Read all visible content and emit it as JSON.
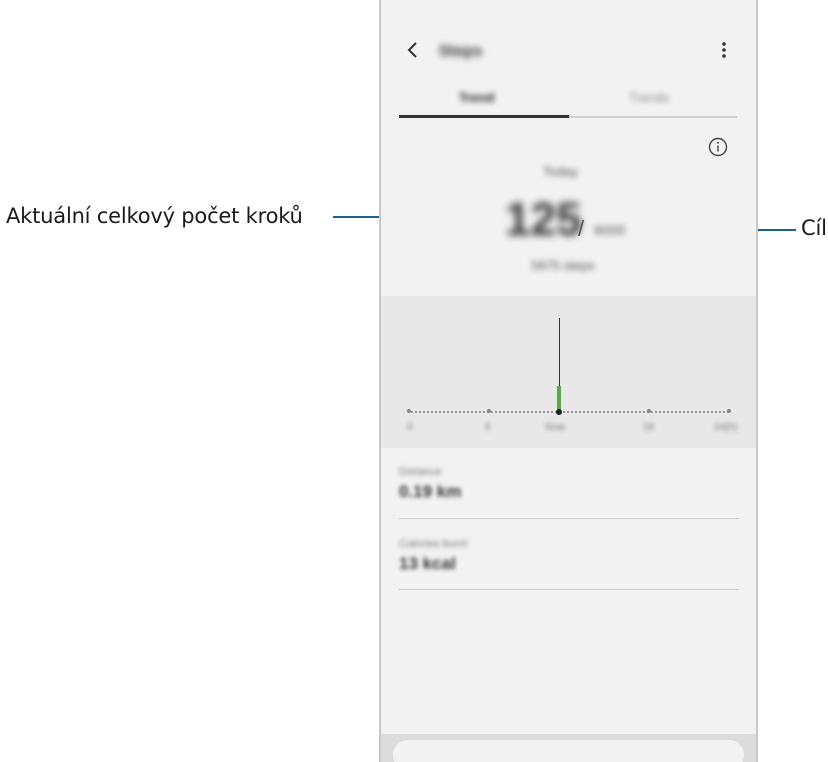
{
  "callouts": {
    "left": "Aktuální celkový počet kroků",
    "right": "Cíl"
  },
  "colors": {
    "leader": "#1f5f8b",
    "progress": "#5aa64a"
  },
  "app": {
    "title": "Steps",
    "back_icon": "chevron-left-icon",
    "menu_icon": "more-vertical-icon",
    "tabs": [
      {
        "label": "Trend"
      },
      {
        "label": "Trends"
      }
    ],
    "info_icon": "info-circle-icon",
    "today_label": "Today",
    "steps_count": "125",
    "separator": "/",
    "goal": "6000",
    "steps_left": "5875 steps"
  },
  "graph": {
    "x_labels": [
      "0",
      "6",
      "Now",
      "18",
      "24(h)"
    ]
  },
  "stats": [
    {
      "label": "Distance",
      "value": "0.19 km"
    },
    {
      "label": "Calories burnt",
      "value": "13 kcal"
    }
  ]
}
